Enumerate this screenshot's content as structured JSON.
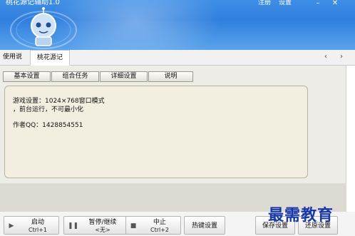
{
  "window": {
    "title": "桃花源记辅助1.0"
  },
  "header": {
    "register_label": "注册",
    "settings_label": "设置",
    "min_glyph": "–",
    "close_glyph": "✕",
    "mascot_icon": "robot-mascot"
  },
  "outer_tabs": [
    {
      "label": "使用说明",
      "active": false
    },
    {
      "label": "桃花源记",
      "active": true
    }
  ],
  "tab_nav": {
    "prev": "‹",
    "next": "›"
  },
  "inner_tabs": [
    {
      "label": "基本设置"
    },
    {
      "label": "组合任务"
    },
    {
      "label": "详细设置"
    },
    {
      "label": "说明"
    }
  ],
  "panel": {
    "line1": "游戏设置：1024×768窗口模式",
    "line2": "，前台运行，不可最小化",
    "line3": "作者QQ：1428854551"
  },
  "buttons": {
    "start": {
      "label": "启动",
      "hotkey": "Ctrl+1",
      "icon": "play-icon"
    },
    "pause": {
      "label": "暂停/继续",
      "hotkey": "<无>",
      "icon": "pause-icon"
    },
    "stop": {
      "label": "中止",
      "hotkey": "Ctrl+2",
      "icon": "stop-icon"
    },
    "hotkey": {
      "label": "热键设置"
    },
    "save": {
      "label": "保存设置"
    },
    "restore": {
      "label": "还原设置"
    }
  },
  "watermark": "最需教育",
  "colors": {
    "header_blue": "#2f7fde",
    "panel_bg": "#f2efe0",
    "content_bg": "#eeece6",
    "watermark": "#1838a8"
  }
}
